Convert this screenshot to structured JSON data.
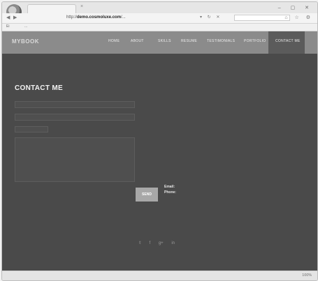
{
  "browser": {
    "tab_title": "",
    "address_prefix": "http://",
    "address_domain": "demo.cosmoluxe.com",
    "address_path": "/...",
    "search_placeholder": "",
    "favorites": [
      "Ei",
      "..."
    ],
    "status": "100%"
  },
  "site": {
    "brand": "MYBOOK",
    "nav": [
      "HOME",
      "ABOUT",
      "SKILLS",
      "RESUME",
      "TESTIMONIALS",
      "PORTFOLIO",
      "CONTACT ME"
    ],
    "active_nav": "CONTACT ME"
  },
  "contact": {
    "heading": "CONTACT ME",
    "send_label": "SEND",
    "email_label": "Email:",
    "phone_label": "Phone:"
  }
}
